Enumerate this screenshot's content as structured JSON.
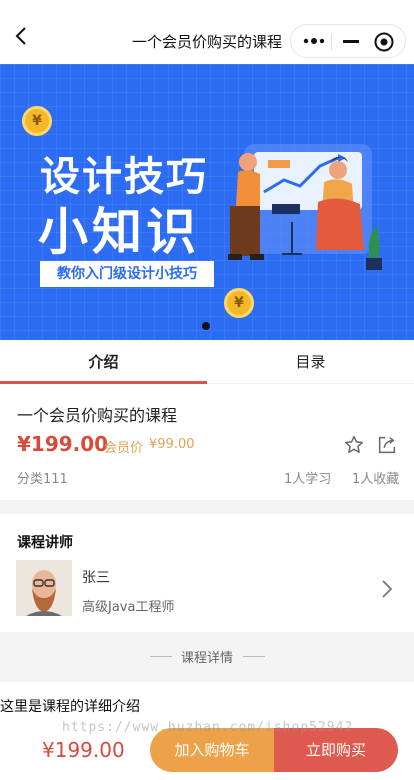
{
  "navbar": {
    "title": "一个会员价购买的课程",
    "back_icon": "chevron-left-icon",
    "capsule_icons": [
      "more-dots-icon",
      "minimize-icon",
      "close-circle-icon"
    ]
  },
  "banner": {
    "title_line1": "设计技巧",
    "title_line2": "小知识",
    "tagline": "教你入门级设计小技巧",
    "coin_symbol": "¥",
    "background_color": "#2c6cf3"
  },
  "tabs": [
    {
      "label": "介绍",
      "active": true
    },
    {
      "label": "目录",
      "active": false
    }
  ],
  "course": {
    "name": "一个会员价购买的课程",
    "price": "¥199.00",
    "member_label": "会员价",
    "member_price": "¥99.00",
    "category": "分类111",
    "learners": "1人学习",
    "favorites": "1人收藏"
  },
  "instructor": {
    "heading": "课程讲师",
    "name": "张三",
    "title": "高级Java工程师"
  },
  "details": {
    "section_label": "课程详情",
    "text": "这里是课程的详细介绍"
  },
  "watermark": "https://www.huzhan.com/ishop52942",
  "bottom_bar": {
    "price": "¥199.00",
    "cart_label": "加入购物车",
    "buy_label": "立即购买",
    "cart_color": "#eda24a",
    "buy_color": "#df5a4e"
  }
}
